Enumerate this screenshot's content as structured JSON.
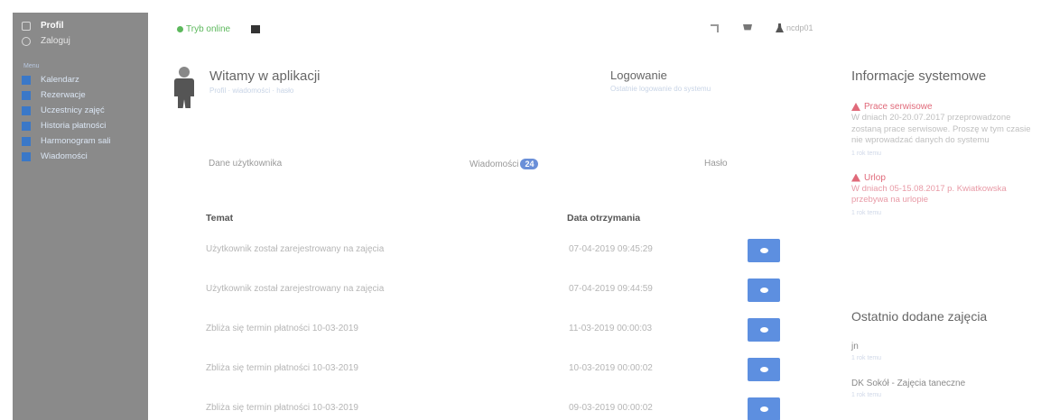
{
  "sidebar": {
    "top_items": [
      {
        "label": "Profil",
        "icon": "user-icon"
      },
      {
        "label": "Zaloguj",
        "icon": "power-icon"
      }
    ],
    "section_label": "Menu",
    "items": [
      {
        "label": "Kalendarz",
        "icon": "calendar-icon"
      },
      {
        "label": "Rezerwacje",
        "icon": "home-icon"
      },
      {
        "label": "Uczestnicy zajęć",
        "icon": "filter-icon"
      },
      {
        "label": "Historia płatności",
        "icon": "payment-icon"
      },
      {
        "label": "Harmonogram sali",
        "icon": "schedule-icon"
      },
      {
        "label": "Wiadomości",
        "icon": "envelope-icon"
      }
    ]
  },
  "topbar": {
    "status": "Tryb online",
    "user_label": "ncdp01"
  },
  "welcome": {
    "title": "Witamy w aplikacji",
    "subtitle": "Profil · wiadomości · hasło"
  },
  "login": {
    "title": "Logowanie",
    "subtitle": "Ostatnie logowanie do systemu"
  },
  "tabs": [
    {
      "label": "Dane użytkownika"
    },
    {
      "label": "Wiadomości",
      "badge": "24"
    },
    {
      "label": "Hasło"
    }
  ],
  "table": {
    "col_subject": "Temat",
    "col_date": "Data otrzymania",
    "rows": [
      {
        "subject": "Użytkownik został zarejestrowany na zajęcia",
        "date": "07-04-2019 09:45:29"
      },
      {
        "subject": "Użytkownik został zarejestrowany na zajęcia",
        "date": "07-04-2019 09:44:59"
      },
      {
        "subject": "Zbliża się termin płatności 10-03-2019",
        "date": "11-03-2019 00:00:03"
      },
      {
        "subject": "Zbliża się termin płatności 10-03-2019",
        "date": "10-03-2019 00:00:02"
      },
      {
        "subject": "Zbliża się termin płatności 10-03-2019",
        "date": "09-03-2019 00:00:02"
      }
    ]
  },
  "system": {
    "title": "Informacje systemowe",
    "notices": [
      {
        "heading": "Prace serwisowe",
        "body": "W dniach 20-20.07.2017 przeprowadzone zostaną prace serwisowe. Proszę w tym czasie nie wprowadzać danych do systemu",
        "time": "1 rok temu"
      },
      {
        "heading": "Urlop",
        "body": "W dniach 05-15.08.2017 p. Kwiatkowska przebywa na urlopie",
        "time": "1 rok temu"
      }
    ]
  },
  "recent": {
    "title": "Ostatnio dodane zajęcia",
    "items": [
      {
        "label": "jn",
        "time": "1 rok temu"
      },
      {
        "label": "DK Sokół - Zajęcia taneczne",
        "time": "1 rok temu"
      }
    ]
  },
  "colors": {
    "sidebar_bg": "#8a8a8a",
    "accent_blue": "#5d8fe0",
    "online_green": "#5cb85c",
    "alert_pink": "#e06a7a"
  }
}
